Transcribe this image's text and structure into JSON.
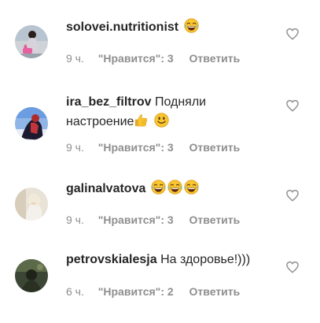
{
  "comments": [
    {
      "username": "solovei.nutritionist",
      "text": "",
      "emoji": [
        "laughing-crying-face"
      ],
      "time": "9 ч.",
      "likes": "\"Нравится\": 3",
      "reply": "Ответить"
    },
    {
      "username": "ira_bez_filtrov",
      "text": "Подняли",
      "text2": "настроение",
      "emoji": [
        "thumbs-up",
        "smiling-face"
      ],
      "time": "9 ч.",
      "likes": "\"Нравится\": 3",
      "reply": "Ответить"
    },
    {
      "username": "galinalvatova",
      "text": "",
      "emoji": [
        "laughing-crying-face",
        "laughing-crying-face",
        "laughing-crying-face"
      ],
      "time": "9 ч.",
      "likes": "\"Нравится\": 3",
      "reply": "Ответить"
    },
    {
      "username": "petrovskialesja",
      "text": "На здоровье!)))",
      "emoji": [],
      "time": "6 ч.",
      "likes": "\"Нравится\": 2",
      "reply": "Ответить"
    }
  ],
  "colors": {
    "text": "#262626",
    "meta": "#8e8e8e",
    "heart_outline": "#8e8e8e",
    "emoji_yellow": "#f9c531"
  },
  "icons": {
    "like": "heart-outline-icon"
  }
}
